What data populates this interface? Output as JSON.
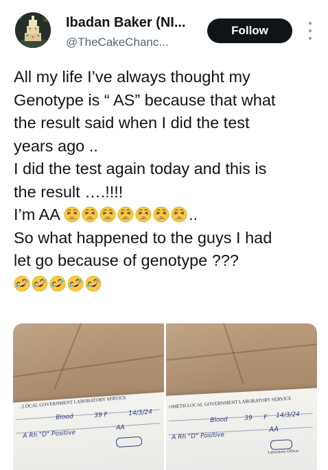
{
  "user": {
    "display_name": "Ibadan Baker (NI...",
    "handle": "@TheCakeChanc..."
  },
  "follow_label": "Follow",
  "tweet": {
    "lines": [
      "All my life I’ve always thought my",
      "Genotype is “ AS” because that what",
      "the result said when I did the test",
      "years ago ..",
      "I did the test again today and this is",
      "the result ….!!!!",
      "I’m AA",
      "..",
      "So what happened to the guys I had",
      "let go because of genotype ???"
    ],
    "tired_face_count": 7,
    "laughing_count": 5
  },
  "media": {
    "left_photo": {
      "form_header": "...LOCAL GOVERNMENT LABORATORY SERVICE",
      "specimen": "Blood",
      "age_sex": "39   F",
      "date": "14/3/24",
      "result": "AA",
      "name_line": "A Rh \"D\" Positive"
    },
    "right_photo": {
      "form_header": "OMETH LOCAL GOVERNMENT LABORATORY SERVICE",
      "specimen": "Blood",
      "age": "39",
      "sex": "F",
      "date": "14/3/24",
      "result": "AA",
      "blood_group": "A Rh \"D\" Positive",
      "signature": "Laboratory Officer"
    }
  },
  "colors": {
    "text": "#0f1419",
    "muted": "#536471",
    "follow_bg": "#0f1419",
    "follow_text": "#ffffff"
  }
}
